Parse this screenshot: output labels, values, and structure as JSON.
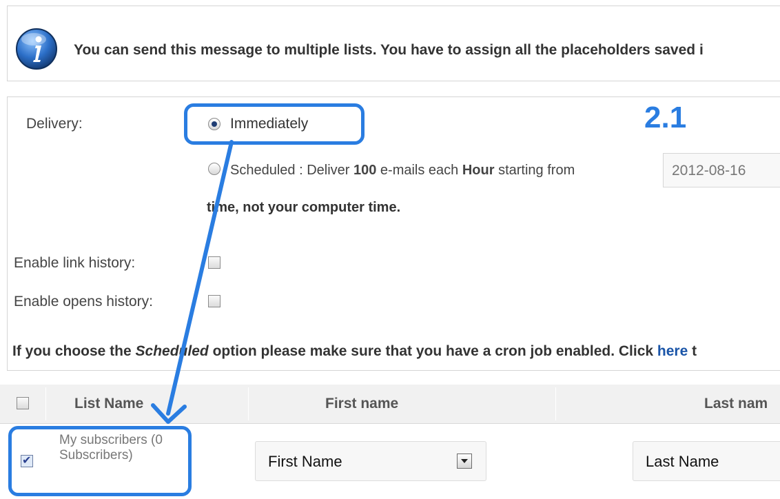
{
  "info": {
    "text": "You can send this message to multiple lists. You have to assign all the placeholders saved i"
  },
  "delivery": {
    "label": "Delivery:",
    "immediately": "Immediately",
    "scheduled_prefix": "Scheduled : Deliver ",
    "scheduled_count": "100",
    "scheduled_mid": " e-mails each ",
    "scheduled_unit": "Hour",
    "scheduled_suffix": " starting from",
    "date_value": "2012-08-16",
    "time_note": "time, not your computer time."
  },
  "options": {
    "link_history_label": "Enable link history:",
    "opens_history_label": "Enable opens history:"
  },
  "note": {
    "prefix": "If you choose the ",
    "italic": "Scheduled",
    "middle": " option please make sure that you have a cron job enabled. Click ",
    "link": "here",
    "suffix": " t"
  },
  "table": {
    "headers": [
      "List Name",
      "First name",
      "Last nam"
    ],
    "rows": [
      {
        "list_name": "My subscribers (0 Subscribers)",
        "first": "First Name",
        "last": "Last Name",
        "checked": true
      }
    ]
  },
  "annotation": {
    "step": "2.1",
    "color": "#2a7de1"
  }
}
